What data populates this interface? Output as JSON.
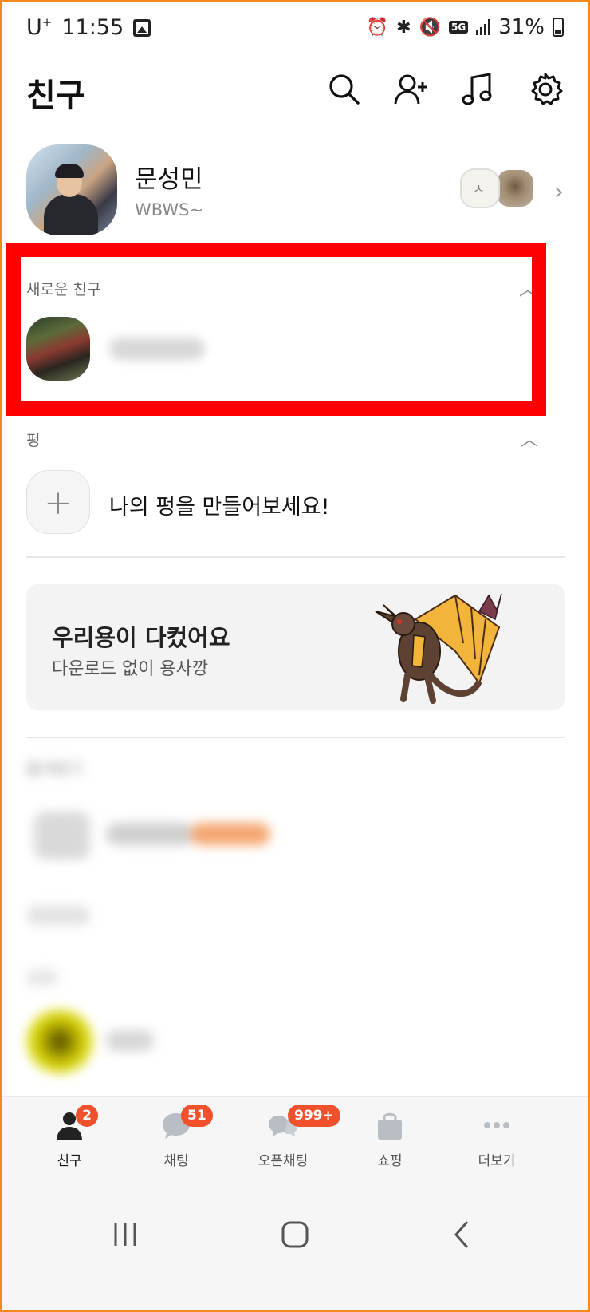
{
  "status_bar": {
    "carrier": "U",
    "carrier_sup": "+",
    "time": "11:55",
    "network": "5G",
    "battery": "31%"
  },
  "header": {
    "title": "친구",
    "icons": [
      "search-icon",
      "add-friend-icon",
      "music-icon",
      "settings-icon"
    ]
  },
  "my_profile": {
    "name": "문성민",
    "status": "WBWS~"
  },
  "new_friends": {
    "label": "새로운 친구"
  },
  "pung": {
    "label": "펑",
    "cta": "나의 펑을 만들어보세요!"
  },
  "banner": {
    "title": "우리용이 다컸어요",
    "subtitle": "다운로드 없이 용사깡"
  },
  "favorites": {
    "label": "즐겨찾기"
  },
  "bottom_nav": {
    "items": [
      {
        "label": "친구",
        "badge": "2",
        "icon": "person-icon",
        "active": true
      },
      {
        "label": "채팅",
        "badge": "51",
        "icon": "chat-bubble-icon",
        "active": false
      },
      {
        "label": "오픈채팅",
        "badge": "999+",
        "icon": "open-chat-icon",
        "active": false
      },
      {
        "label": "쇼핑",
        "badge": "",
        "icon": "shopping-bag-icon",
        "active": false
      },
      {
        "label": "더보기",
        "badge": "",
        "icon": "more-dots-icon",
        "active": false
      }
    ]
  },
  "colors": {
    "frame": "#f38a1e",
    "highlight": "#ff0000",
    "badge": "#f0512c"
  }
}
